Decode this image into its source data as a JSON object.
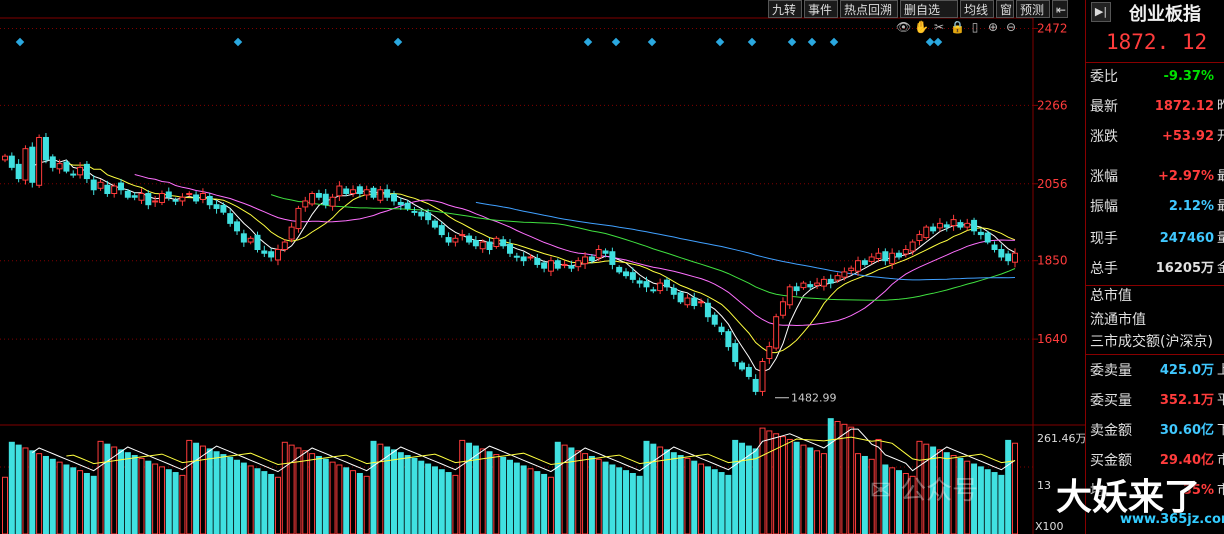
{
  "toolbar": {
    "buttons": [
      "九转",
      "事件",
      "热点回溯",
      "删自选",
      "均线",
      "窗",
      "预测"
    ]
  },
  "icons": [
    "eye-icon",
    "hand-icon",
    "scissors-icon",
    "lock-icon",
    "file-icon",
    "zoom-in-icon",
    "zoom-out-icon"
  ],
  "panel": {
    "name": "创业板指",
    "price": "1872. 12",
    "rows": [
      {
        "label": "委比",
        "value": "-9.37%",
        "color": "#00e000",
        "tail": ""
      },
      {
        "label": "最新",
        "value": "1872.12",
        "color": "#ff3c3c",
        "tail": "昨"
      },
      {
        "label": "涨跌",
        "value": "+53.92",
        "color": "#ff3c3c",
        "tail": "开"
      },
      {
        "label": "涨幅",
        "value": "+2.97%",
        "color": "#ff3c3c",
        "tail": "最"
      },
      {
        "label": "振幅",
        "value": "2.12%",
        "color": "#40c8ff",
        "tail": "最"
      },
      {
        "label": "现手",
        "value": "247460",
        "color": "#40c8ff",
        "tail": "量"
      },
      {
        "label": "总手",
        "value": "16205万",
        "color": "#e0e0e0",
        "tail": "金"
      }
    ],
    "market": [
      {
        "label": "总市值"
      },
      {
        "label": "流通市值"
      },
      {
        "label": "三市成交额(沪深京)"
      }
    ],
    "orders": [
      {
        "label": "委卖量",
        "value": "425.0万",
        "color": "#40c8ff",
        "tail": "上"
      },
      {
        "label": "委买量",
        "value": "352.1万",
        "color": "#ff3c3c",
        "tail": "平"
      },
      {
        "label": "卖金额",
        "value": "30.60亿",
        "color": "#40c8ff",
        "tail": "下"
      },
      {
        "label": "买金额",
        "value": "29.40亿",
        "color": "#ff3c3c",
        "tail": "市"
      },
      {
        "label": "均",
        "value": "35%",
        "color": "#ff3c3c",
        "tail": "市"
      }
    ]
  },
  "axis": {
    "price_ticks": [
      "2472",
      "2266",
      "2056",
      "1850",
      "1640"
    ],
    "volume_ticks": [
      "261.46万",
      "13"
    ],
    "volume_unit": "X100"
  },
  "annotation": {
    "low_label": "1482.99"
  },
  "watermark": {
    "text": "大妖来了",
    "wechat": "公众号",
    "site": "www.365jz.com"
  },
  "colors": {
    "up": "#ff3c3c",
    "down": "#40e0e0",
    "ma5": "#ffffff",
    "ma10": "#ffff40",
    "ma20": "#ff70ff",
    "ma60": "#40e040",
    "ma120": "#40a0ff",
    "grid": "#800000"
  },
  "chart_data": {
    "type": "candlestick",
    "price_ylim": [
      1410,
      2500
    ],
    "price_ticks": [
      2472,
      2266,
      2056,
      1850,
      1640
    ],
    "low_marker": 1482.99,
    "latest": 1872.12,
    "closes": [
      2130,
      2100,
      2070,
      2150,
      2060,
      2180,
      2120,
      2100,
      2110,
      2090,
      2080,
      2100,
      2070,
      2040,
      2060,
      2030,
      2050,
      2040,
      2020,
      2020,
      2030,
      2000,
      2010,
      2030,
      2020,
      2010,
      2020,
      2030,
      2010,
      2030,
      2000,
      1990,
      1980,
      1950,
      1930,
      1900,
      1910,
      1880,
      1870,
      1860,
      1880,
      1900,
      1940,
      1990,
      2010,
      2030,
      2020,
      2000,
      2020,
      2050,
      2030,
      2040,
      2030,
      2040,
      2020,
      2040,
      2020,
      2010,
      2000,
      1990,
      1980,
      1970,
      1960,
      1940,
      1920,
      1900,
      1910,
      1920,
      1900,
      1890,
      1900,
      1880,
      1910,
      1890,
      1870,
      1860,
      1850,
      1860,
      1840,
      1830,
      1850,
      1830,
      1840,
      1830,
      1850,
      1860,
      1850,
      1880,
      1870,
      1840,
      1820,
      1810,
      1800,
      1790,
      1780,
      1770,
      1790,
      1780,
      1760,
      1740,
      1750,
      1730,
      1740,
      1700,
      1680,
      1660,
      1620,
      1580,
      1560,
      1540,
      1500,
      1580,
      1620,
      1700,
      1740,
      1780,
      1770,
      1790,
      1780,
      1790,
      1800,
      1790,
      1810,
      1820,
      1830,
      1850,
      1840,
      1860,
      1870,
      1850,
      1870,
      1860,
      1880,
      1900,
      1920,
      1940,
      1930,
      1950,
      1940,
      1960,
      1940,
      1950,
      1930,
      1920,
      1900,
      1880,
      1860,
      1850,
      1870
    ]
  }
}
